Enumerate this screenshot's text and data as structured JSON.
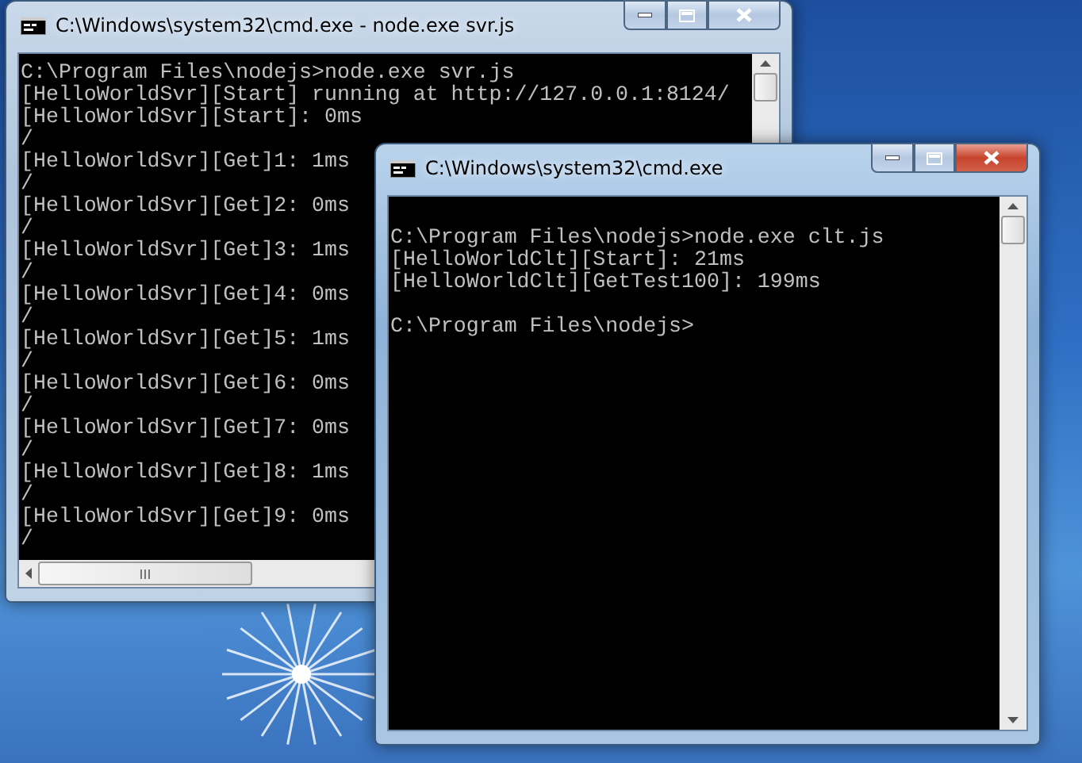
{
  "windows": [
    {
      "title": "C:\\Windows\\system32\\cmd.exe - node.exe  svr.js",
      "active": false,
      "hscroll": true,
      "lines": [
        {
          "kind": "text",
          "text": "C:\\Program Files\\nodejs>node.exe svr.js"
        },
        {
          "kind": "text",
          "text": "[HelloWorldSvr][Start] running at http://127.0.0.1:8124/"
        },
        {
          "kind": "text",
          "text": "[HelloWorldSvr][Start]: 0ms"
        },
        {
          "kind": "text",
          "text": "/"
        },
        {
          "kind": "text",
          "text": "[HelloWorldSvr][Get]1: 1ms"
        },
        {
          "kind": "text",
          "text": "/"
        },
        {
          "kind": "text",
          "text": "[HelloWorldSvr][Get]2: 0ms"
        },
        {
          "kind": "text",
          "text": "/"
        },
        {
          "kind": "text",
          "text": "[HelloWorldSvr][Get]3: 1ms"
        },
        {
          "kind": "text",
          "text": "/"
        },
        {
          "kind": "text",
          "text": "[HelloWorldSvr][Get]4: 0ms"
        },
        {
          "kind": "text",
          "text": "/"
        },
        {
          "kind": "text",
          "text": "[HelloWorldSvr][Get]5: 1ms"
        },
        {
          "kind": "text",
          "text": "/"
        },
        {
          "kind": "text",
          "text": "[HelloWorldSvr][Get]6: 0ms"
        },
        {
          "kind": "text",
          "text": "/"
        },
        {
          "kind": "text",
          "text": "[HelloWorldSvr][Get]7: 0ms"
        },
        {
          "kind": "text",
          "text": "/"
        },
        {
          "kind": "text",
          "text": "[HelloWorldSvr][Get]8: 1ms"
        },
        {
          "kind": "text",
          "text": "/"
        },
        {
          "kind": "text",
          "text": "[HelloWorldSvr][Get]9: 0ms"
        },
        {
          "kind": "text",
          "text": "/"
        }
      ]
    },
    {
      "title": "C:\\Windows\\system32\\cmd.exe",
      "active": true,
      "hscroll": false,
      "lines": [
        {
          "kind": "blank"
        },
        {
          "kind": "text",
          "text": "C:\\Program Files\\nodejs>node.exe clt.js"
        },
        {
          "kind": "text",
          "text": "[HelloWorldClt][Start]: 21ms"
        },
        {
          "kind": "text",
          "text": "[HelloWorldClt][GetTest100]: 199ms"
        },
        {
          "kind": "blank"
        },
        {
          "kind": "text",
          "text": "C:\\Program Files\\nodejs>"
        }
      ]
    }
  ]
}
